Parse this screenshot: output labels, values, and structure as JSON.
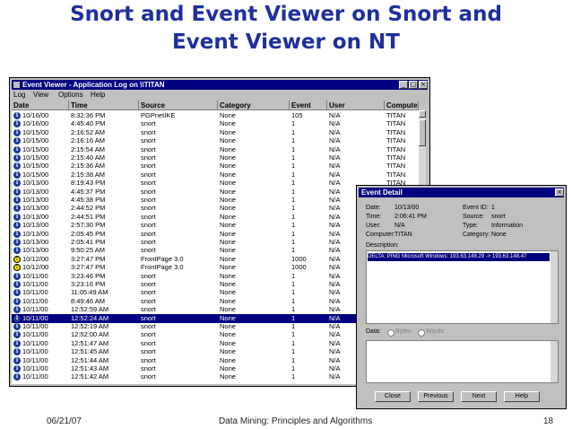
{
  "slide": {
    "title_line1": "Snort and Event Viewer on Snort and",
    "title_line2": "Event Viewer on NT",
    "footer_date": "06/21/07",
    "footer_center": "Data Mining: Principles and Algorithms",
    "footer_page": "18"
  },
  "event_viewer": {
    "title": "Event Viewer - Application Log on \\\\TITAN",
    "window_buttons": [
      "_",
      "□",
      "×"
    ],
    "menu": [
      "Log",
      "View",
      "Options",
      "Help"
    ],
    "columns": [
      "Date",
      "Time",
      "Source",
      "Category",
      "Event",
      "User",
      "Compute"
    ],
    "selected_index": 24,
    "rows": [
      {
        "icon": "info",
        "date": "10/16/00",
        "time": "8:32:36 PM",
        "source": "PGPnetIKE",
        "category": "None",
        "event": "105",
        "user": "N/A",
        "computer": "TITAN"
      },
      {
        "icon": "info",
        "date": "10/16/00",
        "time": "4:45:40 PM",
        "source": "snort",
        "category": "None",
        "event": "1",
        "user": "N/A",
        "computer": "TITAN"
      },
      {
        "icon": "info",
        "date": "10/15/00",
        "time": "2:16:52 AM",
        "source": "snort",
        "category": "None",
        "event": "1",
        "user": "N/A",
        "computer": "TITAN"
      },
      {
        "icon": "info",
        "date": "10/15/00",
        "time": "2:16:16 AM",
        "source": "snort",
        "category": "None",
        "event": "1",
        "user": "N/A",
        "computer": "TITAN"
      },
      {
        "icon": "info",
        "date": "10/15/00",
        "time": "2:15:54 AM",
        "source": "snort",
        "category": "None",
        "event": "1",
        "user": "N/A",
        "computer": "TITAN"
      },
      {
        "icon": "info",
        "date": "10/15/00",
        "time": "2:15:40 AM",
        "source": "snort",
        "category": "None",
        "event": "1",
        "user": "N/A",
        "computer": "TITAN"
      },
      {
        "icon": "info",
        "date": "10/15/00",
        "time": "2:15:36 AM",
        "source": "snort",
        "category": "None",
        "event": "1",
        "user": "N/A",
        "computer": "TITAN"
      },
      {
        "icon": "info",
        "date": "10/15/00",
        "time": "2:15:38 AM",
        "source": "snort",
        "category": "None",
        "event": "1",
        "user": "N/A",
        "computer": "TITAN"
      },
      {
        "icon": "info",
        "date": "10/13/00",
        "time": "8:19:43 PM",
        "source": "snort",
        "category": "None",
        "event": "1",
        "user": "N/A",
        "computer": "TITAN"
      },
      {
        "icon": "info",
        "date": "10/13/00",
        "time": "4:45:37 PM",
        "source": "snort",
        "category": "None",
        "event": "1",
        "user": "N/A",
        "computer": "TITAN"
      },
      {
        "icon": "info",
        "date": "10/13/00",
        "time": "4:45:38 PM",
        "source": "snort",
        "category": "None",
        "event": "1",
        "user": "N/A",
        "computer": "TITAN"
      },
      {
        "icon": "info",
        "date": "10/13/00",
        "time": "2:44:52 PM",
        "source": "snort",
        "category": "None",
        "event": "1",
        "user": "N/A",
        "computer": "TITAN"
      },
      {
        "icon": "info",
        "date": "10/13/00",
        "time": "2:44:51 PM",
        "source": "snort",
        "category": "None",
        "event": "1",
        "user": "N/A",
        "computer": "TITAN"
      },
      {
        "icon": "info",
        "date": "10/13/00",
        "time": "2:57:30 PM",
        "source": "snort",
        "category": "None",
        "event": "1",
        "user": "N/A",
        "computer": "TITAN"
      },
      {
        "icon": "info",
        "date": "10/13/00",
        "time": "2:05:45 PM",
        "source": "snort",
        "category": "None",
        "event": "1",
        "user": "N/A",
        "computer": "TITAN"
      },
      {
        "icon": "info",
        "date": "10/13/00",
        "time": "2:05:41 PM",
        "source": "snort",
        "category": "None",
        "event": "1",
        "user": "N/A",
        "computer": "TITAN"
      },
      {
        "icon": "info",
        "date": "10/13/00",
        "time": "9:50:25 AM",
        "source": "snort",
        "category": "None",
        "event": "1",
        "user": "N/A",
        "computer": "TITAN"
      },
      {
        "icon": "warn",
        "date": "10/12/00",
        "time": "3:27:47 PM",
        "source": "FrontPage 3.0",
        "category": "None",
        "event": "1000",
        "user": "N/A",
        "computer": "TITAN"
      },
      {
        "icon": "warn",
        "date": "10/12/00",
        "time": "3:27:47 PM",
        "source": "FrontPage 3.0",
        "category": "None",
        "event": "1000",
        "user": "N/A",
        "computer": "TITAN"
      },
      {
        "icon": "info",
        "date": "10/11/00",
        "time": "3:23:46 PM",
        "source": "snort",
        "category": "None",
        "event": "1",
        "user": "N/A",
        "computer": "TITAN"
      },
      {
        "icon": "info",
        "date": "10/11/00",
        "time": "3:23:16 PM",
        "source": "snort",
        "category": "None",
        "event": "1",
        "user": "N/A",
        "computer": "TITAN"
      },
      {
        "icon": "info",
        "date": "10/11/00",
        "time": "11:05:49 AM",
        "source": "snort",
        "category": "None",
        "event": "1",
        "user": "N/A",
        "computer": "TITAN"
      },
      {
        "icon": "info",
        "date": "10/11/00",
        "time": "8:49:46 AM",
        "source": "snort",
        "category": "None",
        "event": "1",
        "user": "N/A",
        "computer": "TITAN"
      },
      {
        "icon": "info",
        "date": "10/11/00",
        "time": "12:52:59 AM",
        "source": "snort",
        "category": "None",
        "event": "1",
        "user": "N/A",
        "computer": "TITAN"
      },
      {
        "icon": "info",
        "date": "10/11/00",
        "time": "12:52:24 AM",
        "source": "snort",
        "category": "None",
        "event": "1",
        "user": "N/A",
        "computer": "TITAN"
      },
      {
        "icon": "info",
        "date": "10/11/00",
        "time": "12:52:19 AM",
        "source": "snort",
        "category": "None",
        "event": "1",
        "user": "N/A",
        "computer": "TITAN"
      },
      {
        "icon": "info",
        "date": "10/11/00",
        "time": "12:52:00 AM",
        "source": "snort",
        "category": "None",
        "event": "1",
        "user": "N/A",
        "computer": "TITAN"
      },
      {
        "icon": "info",
        "date": "10/11/00",
        "time": "12:51:47 AM",
        "source": "snort",
        "category": "None",
        "event": "1",
        "user": "N/A",
        "computer": "TITAN"
      },
      {
        "icon": "info",
        "date": "10/11/00",
        "time": "12:51:45 AM",
        "source": "snort",
        "category": "None",
        "event": "1",
        "user": "N/A",
        "computer": "TITAN"
      },
      {
        "icon": "info",
        "date": "10/11/00",
        "time": "12:51:44 AM",
        "source": "snort",
        "category": "None",
        "event": "1",
        "user": "N/A",
        "computer": "TITAN"
      },
      {
        "icon": "info",
        "date": "10/11/00",
        "time": "12:51:43 AM",
        "source": "snort",
        "category": "None",
        "event": "1",
        "user": "N/A",
        "computer": "TITAN"
      },
      {
        "icon": "info",
        "date": "10/11/00",
        "time": "12:51:42 AM",
        "source": "snort",
        "category": "None",
        "event": "1",
        "user": "N/A",
        "computer": "TITAN"
      }
    ]
  },
  "event_detail": {
    "title": "Event Detail",
    "close": "×",
    "date_label": "Date:",
    "date_value": "10/13/00",
    "event_id_label": "Event ID:",
    "event_id_value": "1",
    "time_label": "Time:",
    "time_value": "2:06:41 PM",
    "source_label": "Source:",
    "source_value": "snort",
    "user_label": "User:",
    "user_value": "N/A",
    "type_label": "Type:",
    "type_value": "Information",
    "computer_label": "Computer:",
    "computer_value": "TITAN",
    "category_label": "Category:",
    "category_value": "None",
    "description_label": "Description:",
    "description_text": "DELTA: PING Microsoft Windows: 193.63.148.29 -> 193.63.148.47",
    "data_label": "Data:",
    "bytes_label": "Bytes",
    "words_label": "Words",
    "buttons": [
      "Close",
      "Previous",
      "Next",
      "Help"
    ]
  }
}
